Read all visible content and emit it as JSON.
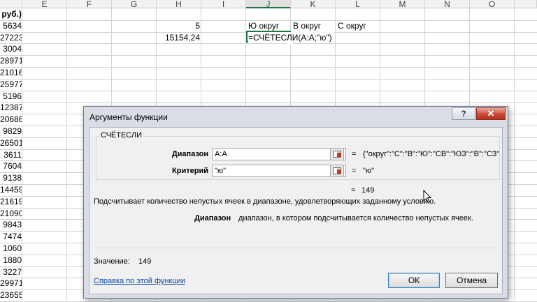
{
  "sheet": {
    "columns": [
      "E",
      "F",
      "G",
      "H",
      "I",
      "J",
      "K",
      "L",
      "M",
      "N",
      "O"
    ],
    "selected_column": "J",
    "colA_values": [
      "руб.)",
      "5634",
      "27223",
      "3004",
      "28971",
      "21016",
      "25977",
      "5196",
      "12387",
      "20686",
      "9829",
      "26501",
      "3611",
      "7604",
      "9138",
      "14459",
      "21619",
      "21090",
      "9843",
      "7474",
      "1060",
      "1880",
      "3227",
      "29971",
      "23655"
    ],
    "h1": "5",
    "h2": "15154,24",
    "j1": "Ю округ",
    "k1": "В округ",
    "l1": "С округ",
    "formula": "=СЧЁТЕСЛИ(A:A;\"ю\")"
  },
  "dialog": {
    "title": "Аргументы функции",
    "help_label": "?",
    "close_label": "✕",
    "function_name": "СЧЁТЕСЛИ",
    "arg1_label": "Диапазон",
    "arg1_value": "A:A",
    "arg1_result": "{\"округ\":\"С\":\"В\":\"Ю\":\"СВ\":\"ЮЗ\":\"В\":\"СЗ\"",
    "arg2_label": "Критерий",
    "arg2_value": "\"ю\"",
    "arg2_result": "\"ю\"",
    "eq": "=",
    "formula_result": "149",
    "description": "Подсчитывает количество непустых ячеек в диапазоне, удовлетворяющих заданному условию.",
    "arg_help_name": "Диапазон",
    "arg_help_text": "диапазон, в котором подсчитывается количество непустых ячеек.",
    "value_label": "Значение:",
    "value": "149",
    "help_link": "Справка по этой функции",
    "ok_label": "ОК",
    "cancel_label": "Отмена"
  }
}
